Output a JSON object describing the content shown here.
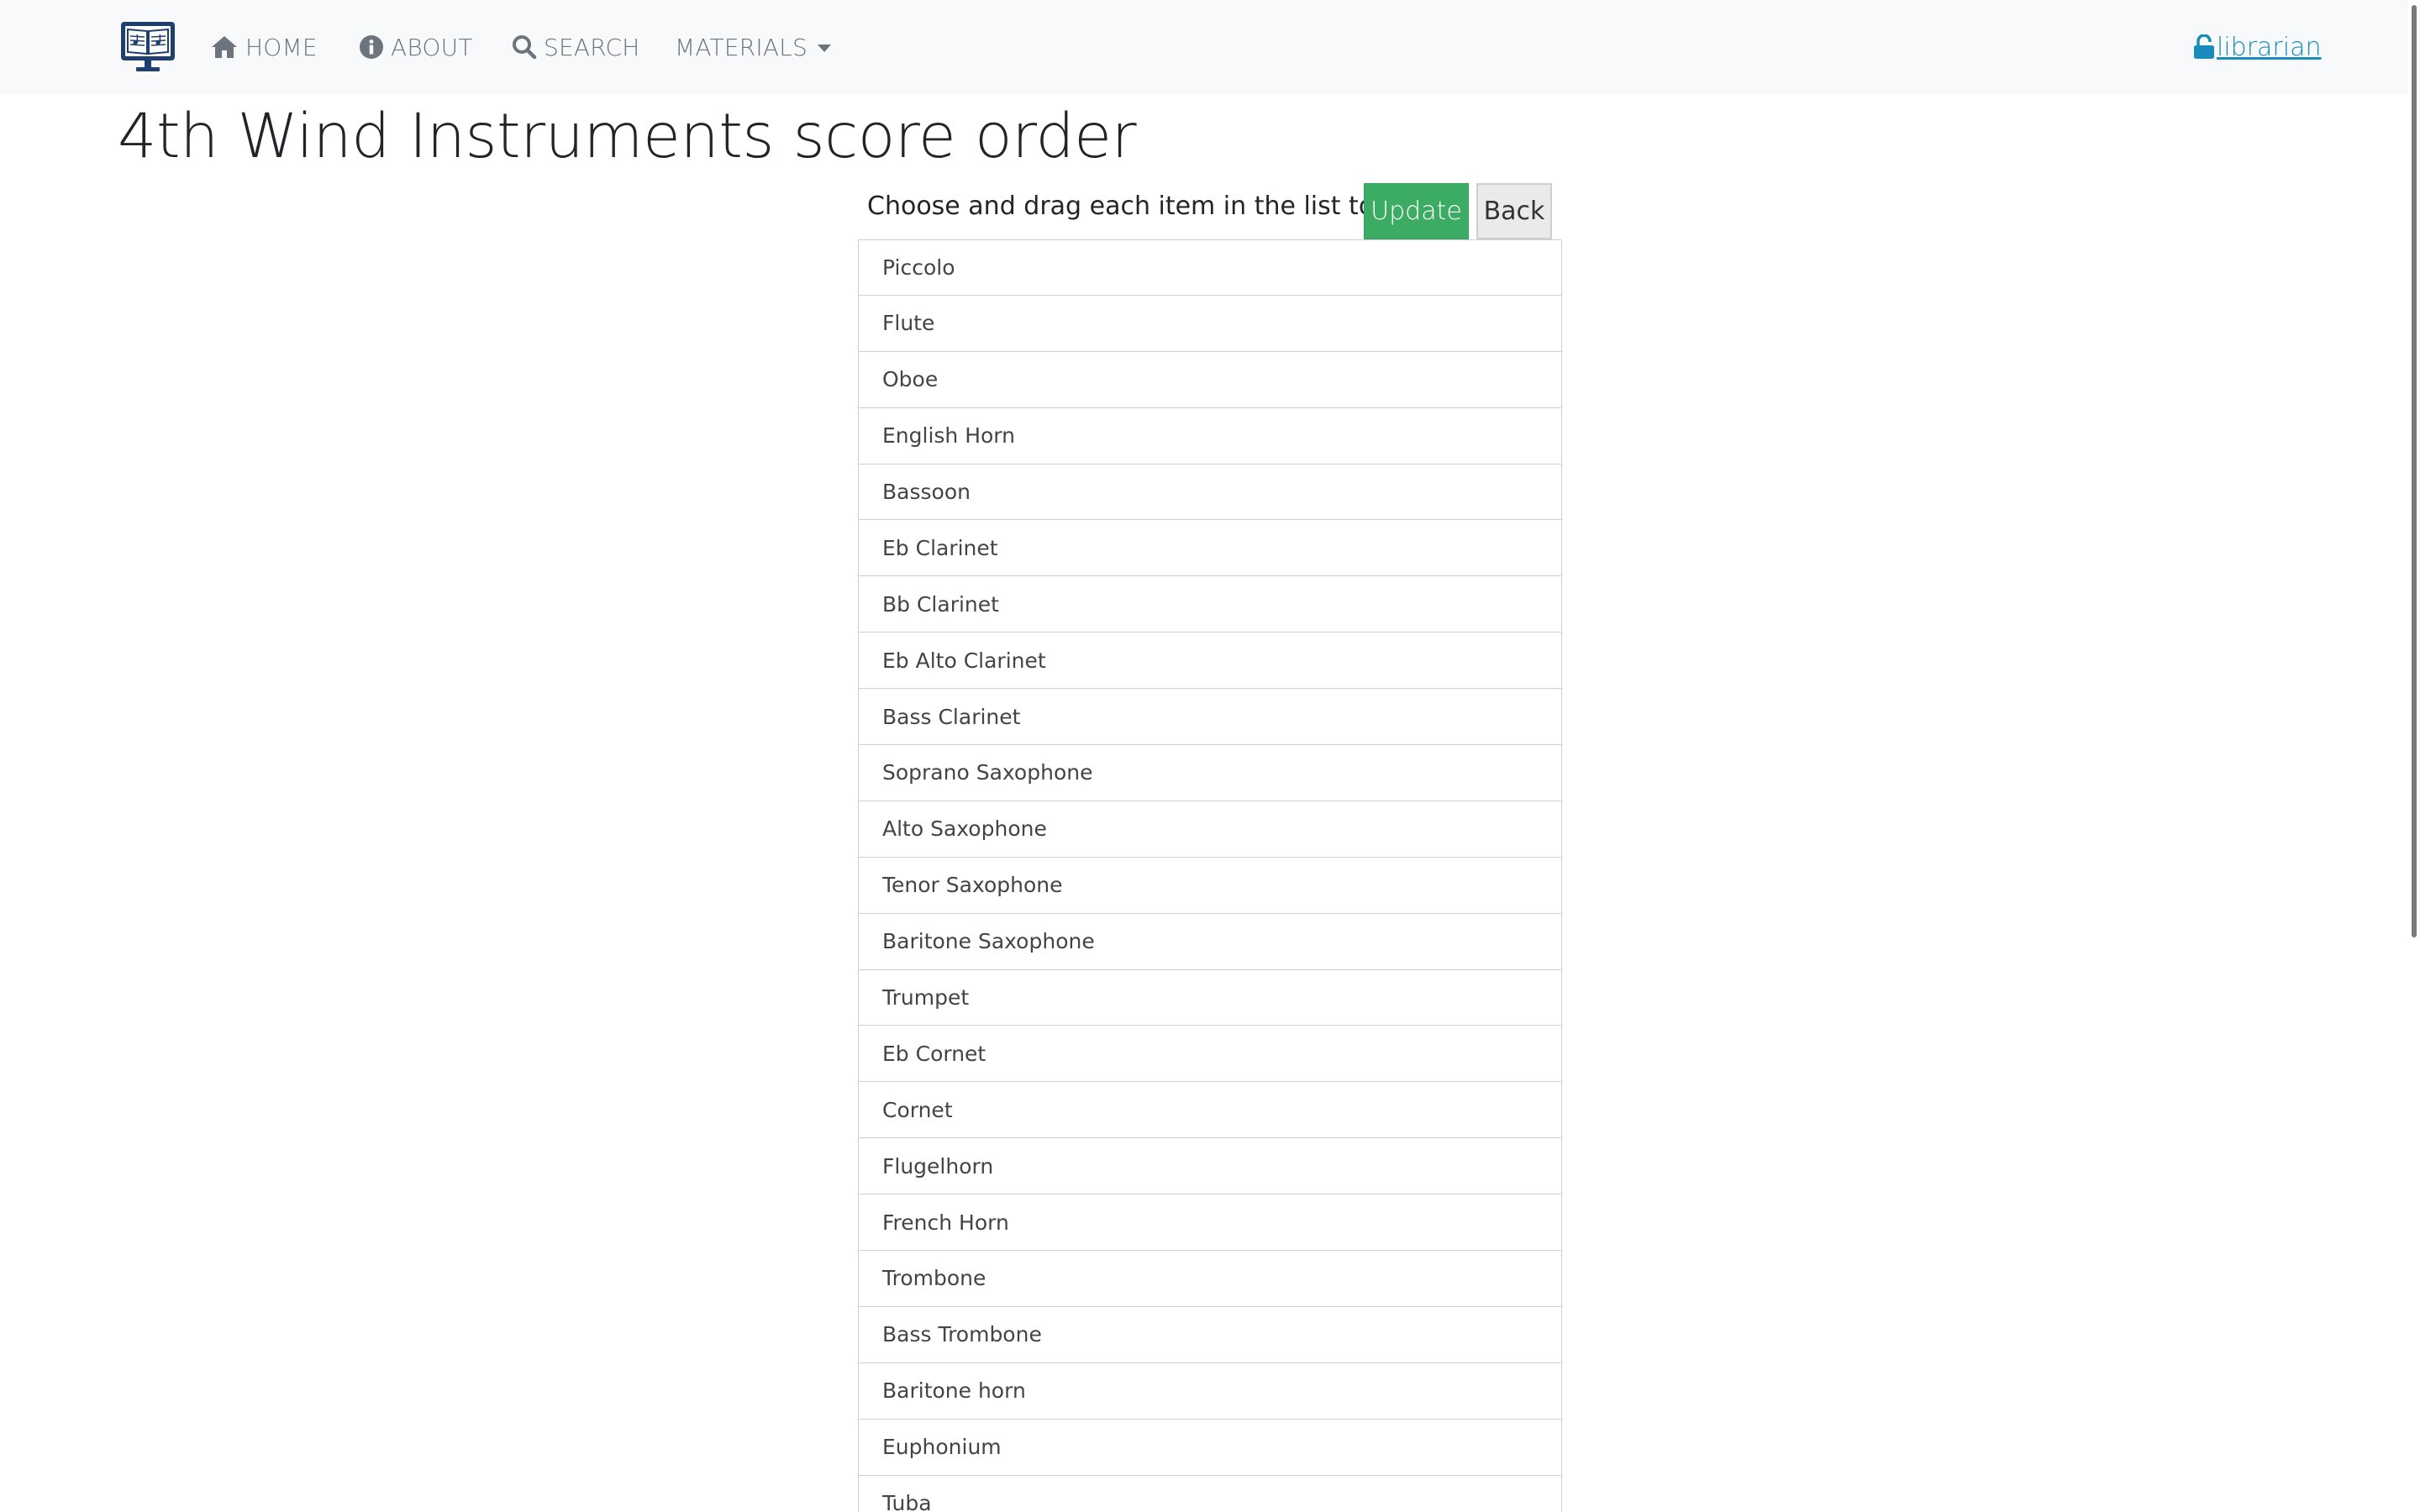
{
  "nav": {
    "home": "HOME",
    "about": "ABOUT",
    "search": "SEARCH",
    "materials": "MATERIALS",
    "user": "librarian"
  },
  "icons": {
    "brand": "sheet-music-monitor-icon",
    "home": "home-icon",
    "about": "info-circle-icon",
    "search": "search-icon",
    "user": "unlock-icon"
  },
  "colors": {
    "brand": "#1f3f6e",
    "update_button": "#3cab64",
    "link": "#1a8bbd"
  },
  "page": {
    "title": "4th Wind Instruments score order",
    "instructions": "Choose and drag each item in the list to sort.",
    "update_label": "Update",
    "back_label": "Back"
  },
  "instruments": [
    "Piccolo",
    "Flute",
    "Oboe",
    "English Horn",
    "Bassoon",
    "Eb Clarinet",
    "Bb Clarinet",
    "Eb Alto Clarinet",
    "Bass Clarinet",
    "Soprano Saxophone",
    "Alto Saxophone",
    "Tenor Saxophone",
    "Baritone Saxophone",
    "Trumpet",
    "Eb Cornet",
    "Cornet",
    "Flugelhorn",
    "French Horn",
    "Trombone",
    "Bass Trombone",
    "Baritone horn",
    "Euphonium",
    "Tuba"
  ]
}
